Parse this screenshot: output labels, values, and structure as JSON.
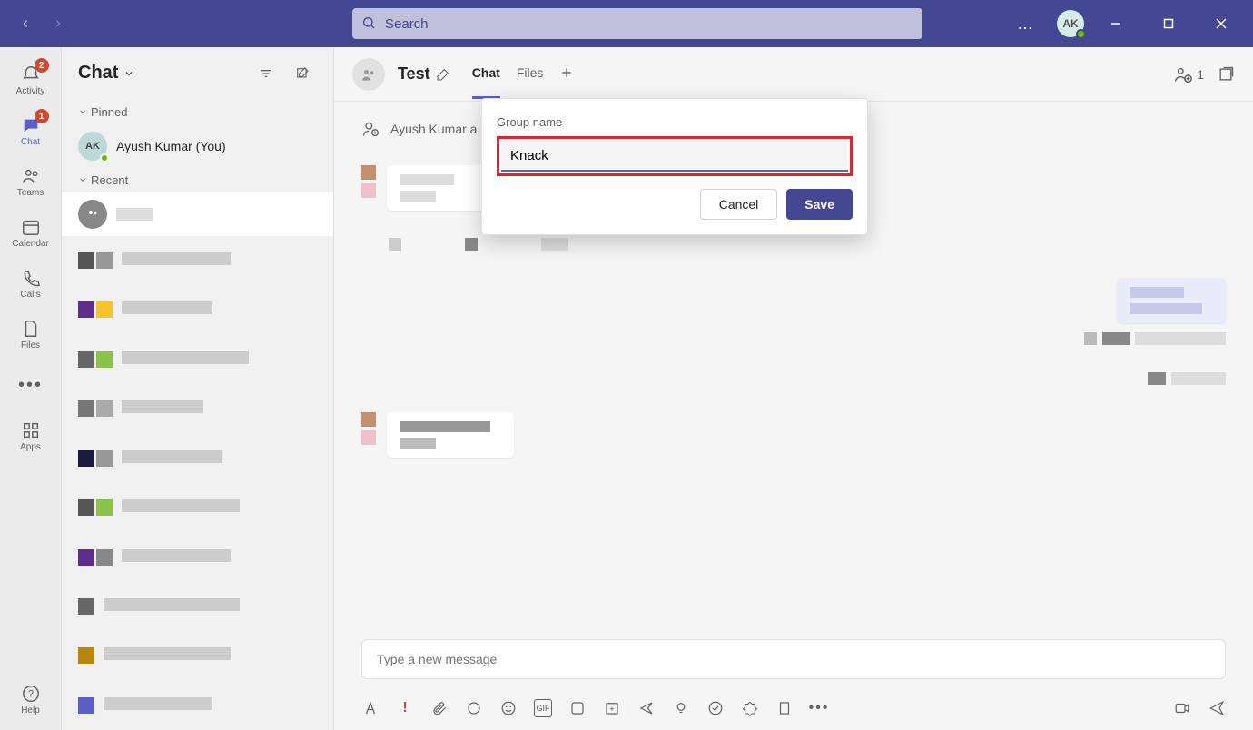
{
  "titlebar": {
    "search_placeholder": "Search",
    "avatar_initials": "AK",
    "more_label": "…"
  },
  "rail": {
    "items": [
      {
        "label": "Activity",
        "badge": "2"
      },
      {
        "label": "Chat",
        "badge": "1"
      },
      {
        "label": "Teams"
      },
      {
        "label": "Calendar"
      },
      {
        "label": "Calls"
      },
      {
        "label": "Files"
      }
    ],
    "more": "…",
    "apps": "Apps",
    "help": "Help"
  },
  "chatlist": {
    "title": "Chat",
    "sections": {
      "pinned": "Pinned",
      "recent": "Recent"
    },
    "pinned_item": {
      "initials": "AK",
      "name": "Ayush Kumar (You)"
    }
  },
  "chat": {
    "title": "Test",
    "tabs": [
      {
        "label": "Chat"
      },
      {
        "label": "Files"
      }
    ],
    "participant_count": "1",
    "add_user_row": "Ayush Kumar a",
    "compose_placeholder": "Type a new message"
  },
  "dialog": {
    "label": "Group name",
    "value": "Knack",
    "cancel": "Cancel",
    "save": "Save"
  }
}
